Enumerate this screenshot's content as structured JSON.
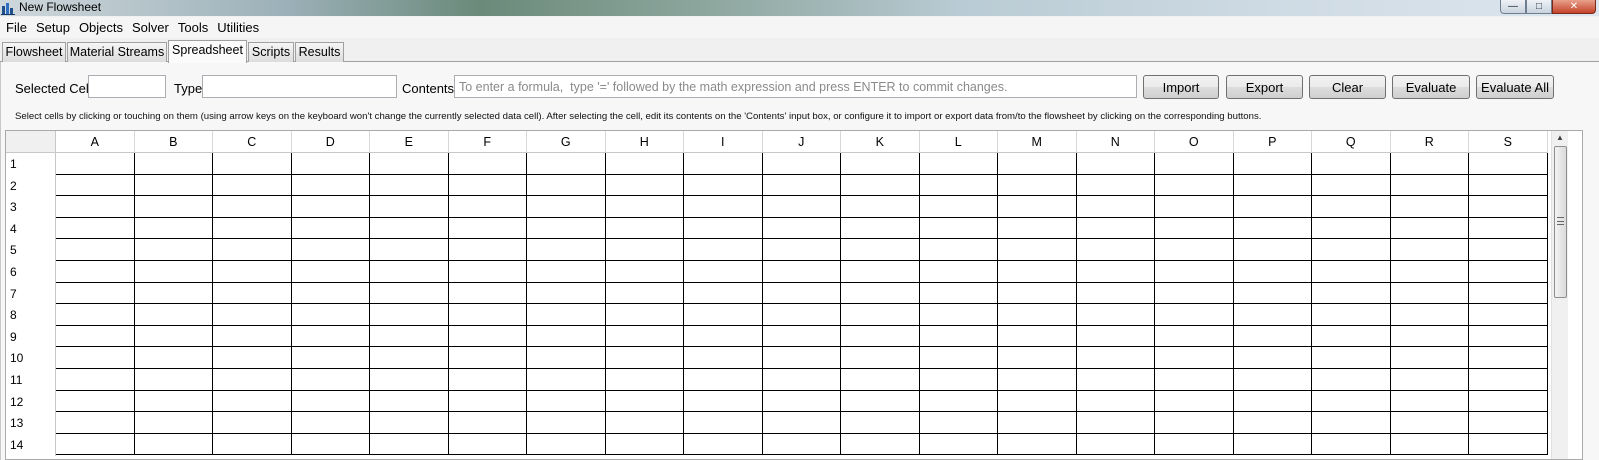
{
  "window": {
    "title": "New Flowsheet"
  },
  "menu": [
    "File",
    "Setup",
    "Objects",
    "Solver",
    "Tools",
    "Utilities"
  ],
  "tabs": [
    {
      "label": "Flowsheet",
      "active": false
    },
    {
      "label": "Material Streams",
      "active": false
    },
    {
      "label": "Spreadsheet",
      "active": true
    },
    {
      "label": "Scripts",
      "active": false
    },
    {
      "label": "Results",
      "active": false
    }
  ],
  "toolbar": {
    "selected_cell_label": "Selected Cell",
    "selected_cell_value": "",
    "type_label": "Type",
    "type_value": "",
    "contents_label": "Contents",
    "contents_placeholder": "To enter a formula,  type '=' followed by the math expression and press ENTER to commit changes.",
    "import_label": "Import",
    "export_label": "Export",
    "clear_label": "Clear",
    "evaluate_label": "Evaluate",
    "evaluate_all_label": "Evaluate All"
  },
  "hint": "Select cells by clicking or touching on them (using arrow keys on the keyboard won't change the currently selected data cell). After selecting the cell, edit its contents on the 'Contents' input box, or configure it to import or export data from/to the flowsheet by clicking on the corresponding buttons.",
  "grid": {
    "columns": [
      "A",
      "B",
      "C",
      "D",
      "E",
      "F",
      "G",
      "H",
      "I",
      "J",
      "K",
      "L",
      "M",
      "N",
      "O",
      "P",
      "Q",
      "R",
      "S"
    ],
    "rows": [
      "1",
      "2",
      "3",
      "4",
      "5",
      "6",
      "7",
      "8",
      "9",
      "10",
      "11",
      "12",
      "13",
      "14"
    ]
  },
  "icons": {
    "app": "flowsheet-app-icon",
    "minimize": "minimize-icon",
    "maximize": "maximize-icon",
    "close": "close-icon",
    "scroll_up": "scroll-up-arrow-icon",
    "grip": "scroll-grip-icon"
  }
}
